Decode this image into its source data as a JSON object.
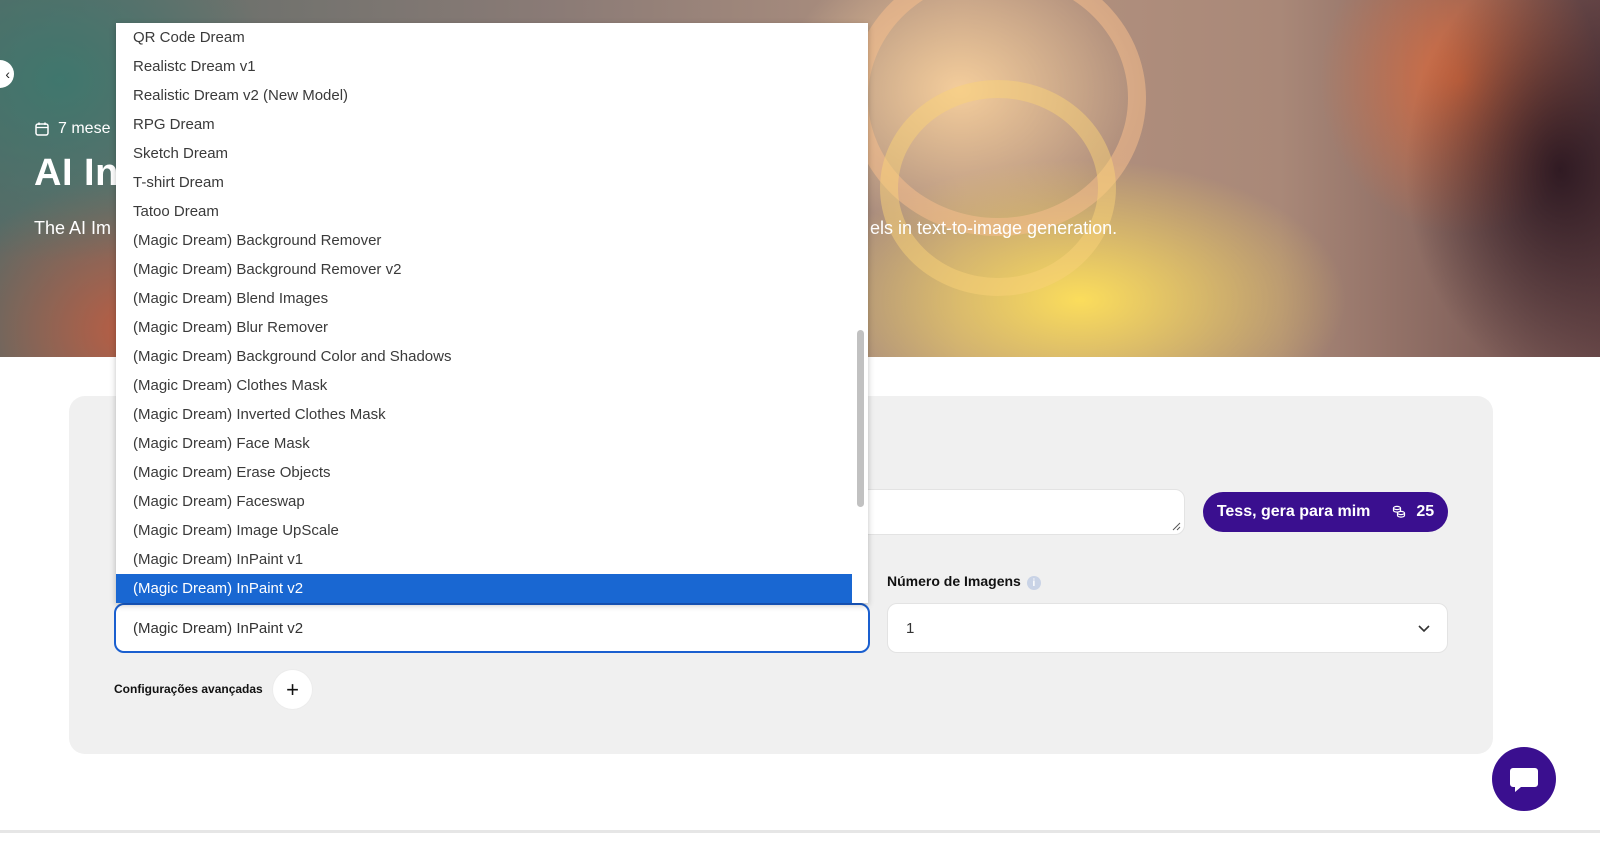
{
  "hero": {
    "date_text": "7 mese",
    "title_text": "AI In",
    "description_left": "The AI Im",
    "description_right": "els in text-to-image generation."
  },
  "form": {
    "tess_button_label": "Tess, gera para mim",
    "credits": "25",
    "num_images_label": "Número de Imagens",
    "num_images_value": "1",
    "model_value": "(Magic Dream) InPaint v2",
    "advanced_label": "Configurações avançadas",
    "advanced_toggle": "+"
  },
  "dropdown": {
    "items": [
      "QR Code Dream",
      "Realistc Dream v1",
      "Realistic Dream v2 (New Model)",
      "RPG Dream",
      "Sketch Dream",
      "T-shirt Dream",
      "Tatoo Dream",
      "(Magic Dream) Background Remover",
      "(Magic Dream) Background Remover v2",
      "(Magic Dream) Blend Images",
      "(Magic Dream) Blur Remover",
      "(Magic Dream) Background Color and Shadows",
      "(Magic Dream) Clothes Mask",
      "(Magic Dream) Inverted Clothes Mask",
      "(Magic Dream) Face Mask",
      "(Magic Dream) Erase Objects",
      "(Magic Dream) Faceswap",
      "(Magic Dream) Image UpScale",
      "(Magic Dream) InPaint v1",
      "(Magic Dream) InPaint v2"
    ],
    "selected_index": 19
  },
  "colors": {
    "brand_purple": "#3a0f8f",
    "selection_blue": "#1967d2",
    "focus_border": "#1a5fcf"
  },
  "icons": {
    "date": "calendar-icon",
    "credits": "coins-icon",
    "chevron": "chevron-down-icon",
    "chat": "chat-icon"
  }
}
